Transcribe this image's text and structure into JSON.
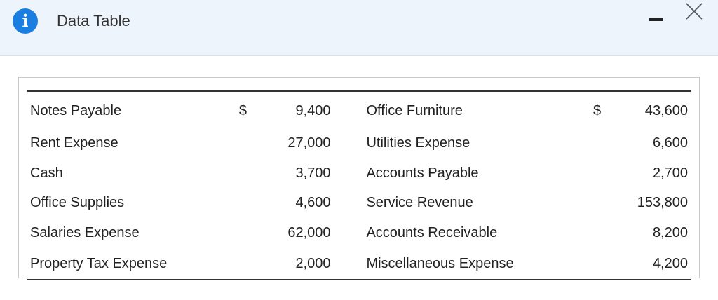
{
  "window": {
    "title": "Data Table",
    "icon": "info-icon",
    "controls": [
      "minimize-icon",
      "close-icon"
    ],
    "accent_color": "#1a7de0"
  },
  "table": {
    "rows": [
      {
        "left_label": "Notes Payable",
        "left_currency": "$",
        "left_amount": "9,400",
        "right_label": "Office Furniture",
        "right_currency": "$",
        "right_amount": "43,600"
      },
      {
        "left_label": "Rent Expense",
        "left_currency": "",
        "left_amount": "27,000",
        "right_label": "Utilities Expense",
        "right_currency": "",
        "right_amount": "6,600"
      },
      {
        "left_label": "Cash",
        "left_currency": "",
        "left_amount": "3,700",
        "right_label": "Accounts Payable",
        "right_currency": "",
        "right_amount": "2,700"
      },
      {
        "left_label": "Office Supplies",
        "left_currency": "",
        "left_amount": "4,600",
        "right_label": "Service Revenue",
        "right_currency": "",
        "right_amount": "153,800"
      },
      {
        "left_label": "Salaries Expense",
        "left_currency": "",
        "left_amount": "62,000",
        "right_label": "Accounts Receivable",
        "right_currency": "",
        "right_amount": "8,200"
      },
      {
        "left_label": "Property Tax Expense",
        "left_currency": "",
        "left_amount": "2,000",
        "right_label": "Miscellaneous Expense",
        "right_currency": "",
        "right_amount": "4,200"
      }
    ]
  }
}
